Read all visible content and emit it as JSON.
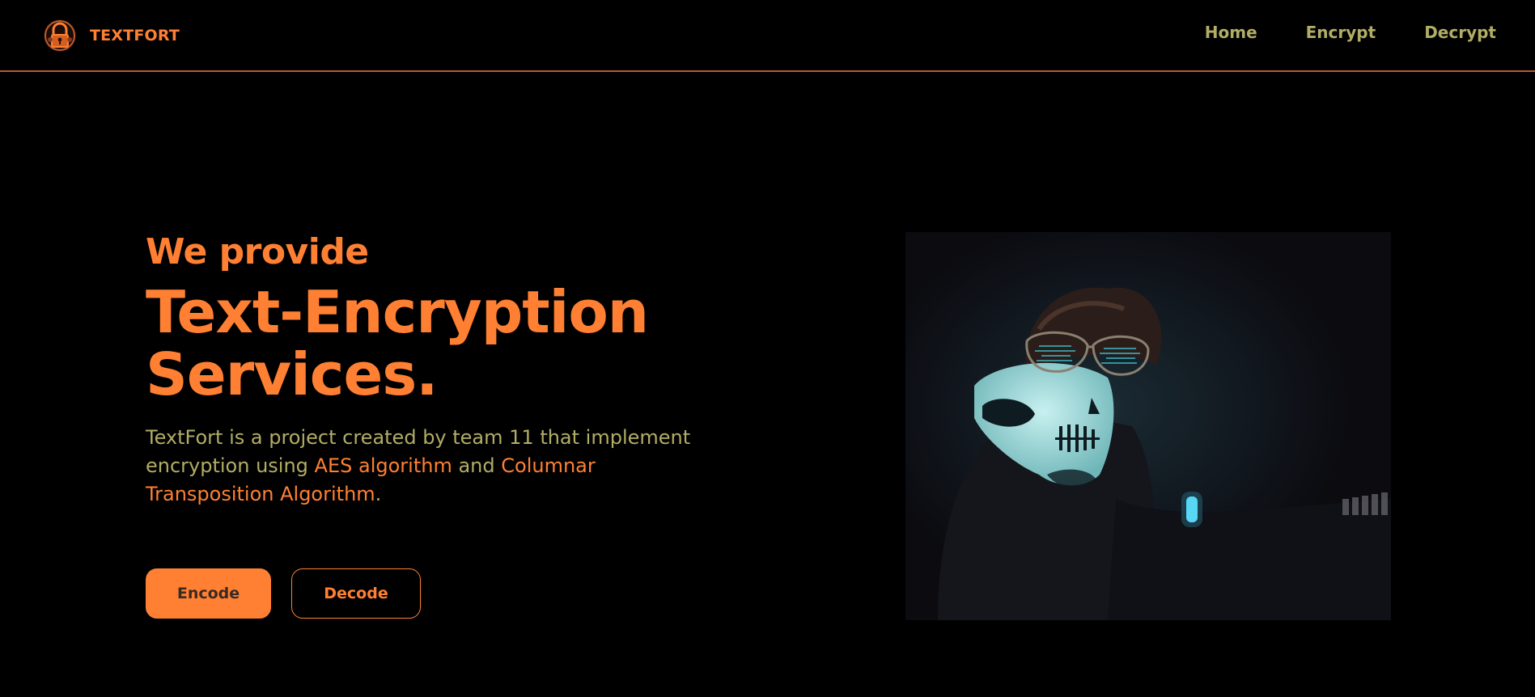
{
  "header": {
    "brand_name": "TEXTFORT",
    "logo_icon": "padlock-logo-icon",
    "nav": [
      {
        "label": "Home"
      },
      {
        "label": "Encrypt"
      },
      {
        "label": "Decrypt"
      }
    ]
  },
  "hero": {
    "eyebrow": "We provide",
    "headline_line1": "Text-Encryption",
    "headline_line2": "Services.",
    "description": {
      "part1": "TextFort is a project created by team 11 that implement encryption using ",
      "highlight1": "AES algorithm",
      "part2": " and ",
      "highlight2": "Columnar Transposition Algorithm",
      "part3": "."
    },
    "buttons": {
      "encode_label": "Encode",
      "decode_label": "Decode"
    },
    "image_icon": "hacker-photo"
  },
  "colors": {
    "background": "#000000",
    "accent": "#ff8033",
    "nav_text": "#b2ad66",
    "body_text": "#b2ad66",
    "divider": "#b45a3c"
  }
}
